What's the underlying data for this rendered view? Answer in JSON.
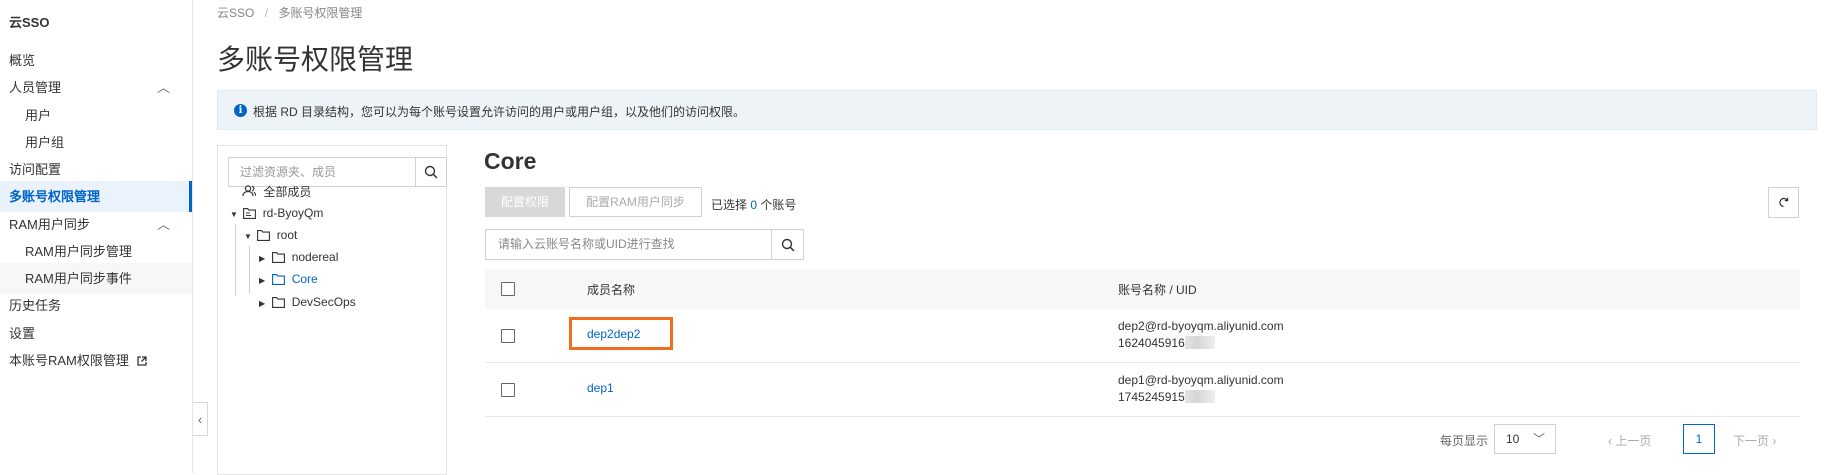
{
  "sidebar": {
    "title": "云SSO",
    "items": [
      {
        "label": "概览"
      },
      {
        "label": "人员管理"
      },
      {
        "label": "用户"
      },
      {
        "label": "用户组"
      },
      {
        "label": "访问配置"
      },
      {
        "label": "多账号权限管理"
      },
      {
        "label": "RAM用户同步"
      },
      {
        "label": "RAM用户同步管理"
      },
      {
        "label": "RAM用户同步事件"
      },
      {
        "label": "历史任务"
      },
      {
        "label": "设置"
      },
      {
        "label": "本账号RAM权限管理"
      }
    ]
  },
  "breadcrumb": {
    "root": "云SSO",
    "sep": "/",
    "current": "多账号权限管理"
  },
  "page": {
    "title": "多账号权限管理",
    "info": "根据 RD 目录结构，您可以为每个账号设置允许访问的用户或用户组，以及他们的访问权限。"
  },
  "tree": {
    "search_placeholder": "过滤资源夹、成员",
    "all_members": "全部成员",
    "rd": "rd-ByoyQm",
    "root": "root",
    "children": [
      "nodereal",
      "Core",
      "DevSecOps"
    ]
  },
  "content": {
    "title": "Core",
    "btn_config": "配置权限",
    "btn_sync": "配置RAM用户同步",
    "selected_prefix": "已选择",
    "selected_count": "0",
    "selected_suffix": "个账号",
    "search_placeholder": "请输入云账号名称或UID进行查找",
    "col_member": "成员名称",
    "col_account": "账号名称 / UID",
    "rows": [
      {
        "member": "dep2dep2",
        "account": "dep2@rd-byoyqm.aliyunid.com",
        "uid": "1624045916"
      },
      {
        "member": "dep1",
        "account": "dep1@rd-byoyqm.aliyunid.com",
        "uid": "1745245915"
      }
    ]
  },
  "pagination": {
    "per_page_label": "每页显示",
    "per_page": "10",
    "prev": "上一页",
    "current": "1",
    "next": "下一页"
  },
  "colors": {
    "accent": "#0064c8",
    "highlight": "#f06e1e"
  }
}
